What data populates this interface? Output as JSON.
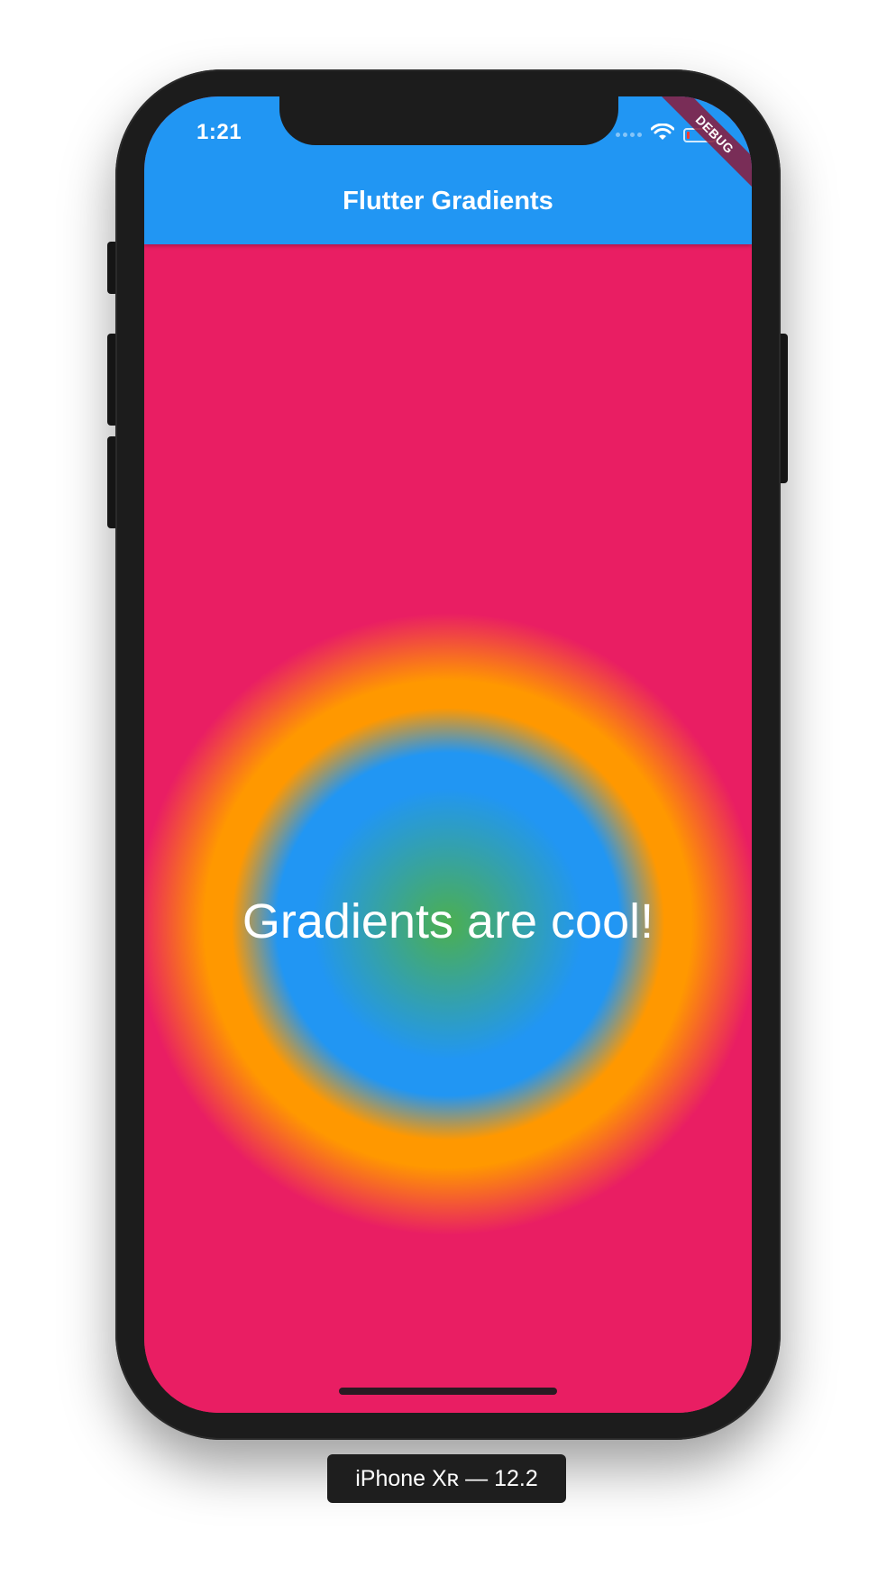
{
  "status_bar": {
    "time": "1:21",
    "icons": [
      "signal-icon",
      "wifi-icon",
      "battery-icon"
    ]
  },
  "app_bar": {
    "title": "Flutter Gradients",
    "color": "#2196f3"
  },
  "debug_banner": {
    "label": "DEBUG"
  },
  "body": {
    "text": "Gradients are cool!",
    "background_color": "#e91e63",
    "gradient": {
      "type": "radial",
      "colors": [
        "#4caf50",
        "#2196f3",
        "#ff9800",
        "#e91e63"
      ]
    }
  },
  "device_label": "iPhone Xʀ — 12.2"
}
